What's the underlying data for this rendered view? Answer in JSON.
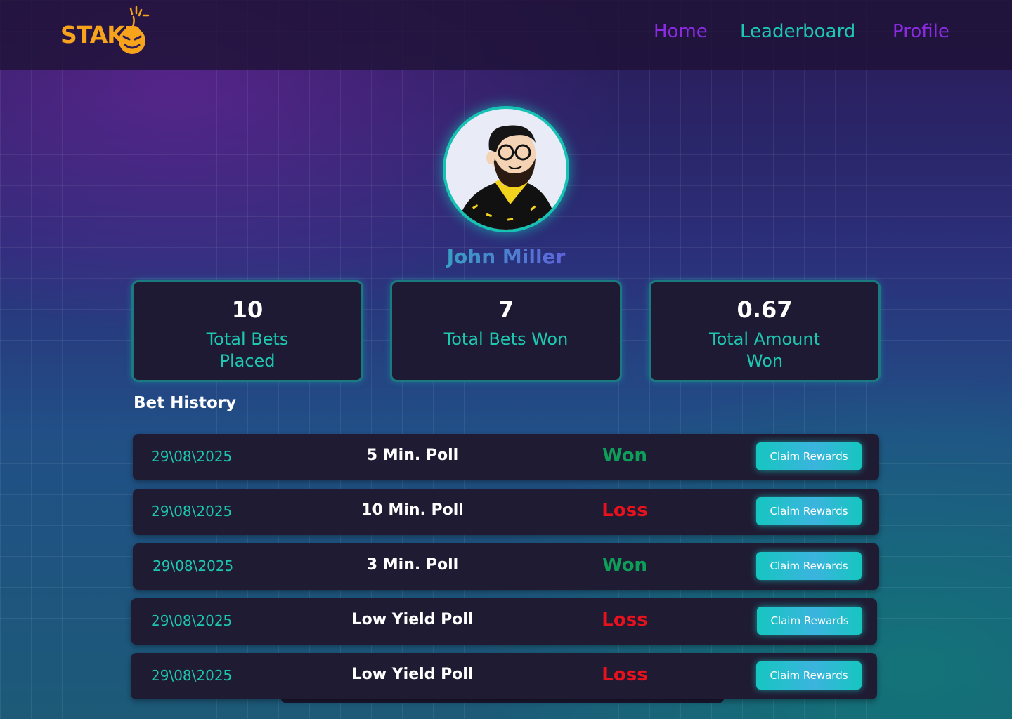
{
  "brand": {
    "logo_text": "STAKR"
  },
  "nav": [
    {
      "label": "Home",
      "color": "#8a2be2"
    },
    {
      "label": "Leaderboard",
      "color": "#1dc7b0"
    },
    {
      "label": "Profile",
      "color": "#8a2be2"
    }
  ],
  "profile": {
    "name": "John Miller"
  },
  "stats": [
    {
      "value": "10",
      "label": "Total Bets Placed"
    },
    {
      "value": "7",
      "label": "Total Bets Won"
    },
    {
      "value": "0.67",
      "label": "Total Amount Won"
    }
  ],
  "bet_history": {
    "title": "Bet History",
    "rows": [
      {
        "date": "29\\08\\2025",
        "poll": "5  Min. Poll",
        "status": "Won",
        "action": "Claim Rewards"
      },
      {
        "date": "29\\08\\2025",
        "poll": "10  Min. Poll",
        "status": "Loss",
        "action": "Claim Rewards"
      },
      {
        "date": "29\\08\\2025",
        "poll": "3 Min. Poll",
        "status": "Won",
        "action": "Claim Rewards"
      },
      {
        "date": "29\\08\\2025",
        "poll": "Low Yield Poll",
        "status": "Loss",
        "action": "Claim Rewards"
      },
      {
        "date": "29\\08\\2025",
        "poll": "Low Yield Poll",
        "status": "Loss",
        "action": "Claim Rewards"
      }
    ]
  },
  "colors": {
    "won": "#0e9e5a",
    "loss": "#e8121c",
    "accent_teal": "#1dc7b0",
    "accent_purple": "#8a2be2",
    "logo_orange": "#f7a31c"
  }
}
